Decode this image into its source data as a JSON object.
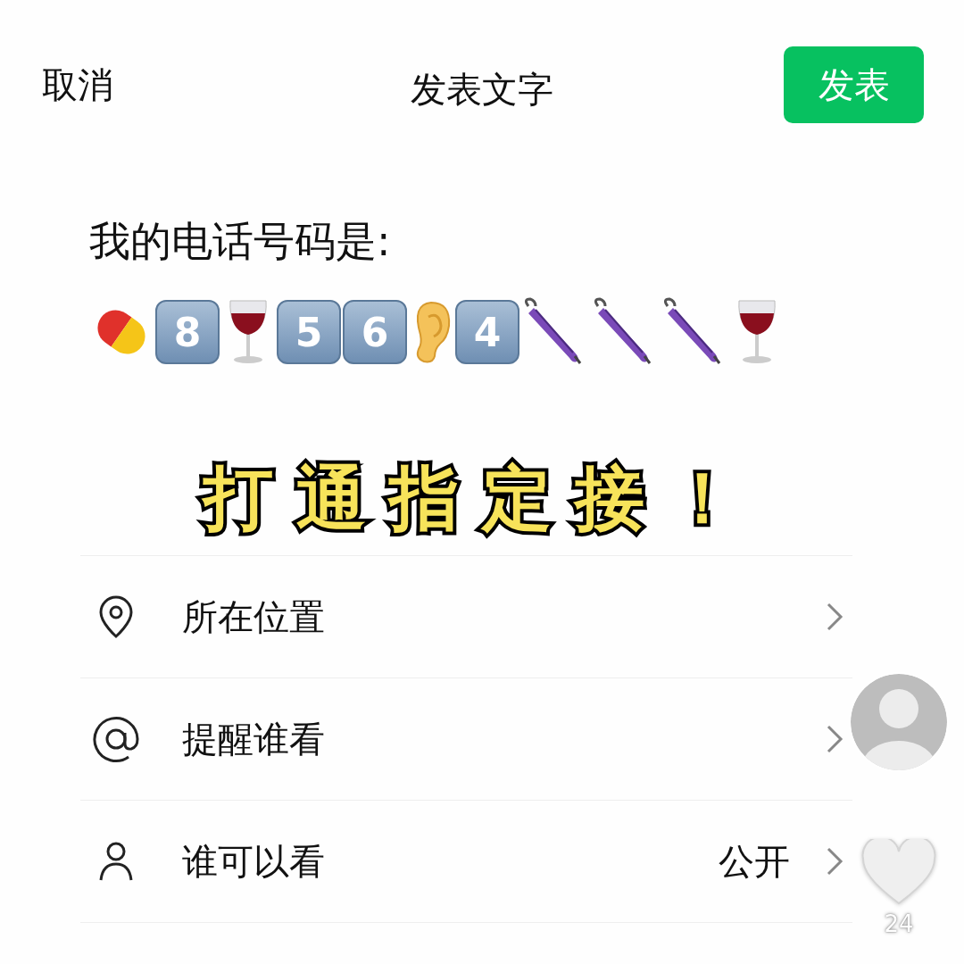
{
  "header": {
    "cancel": "取消",
    "title": "发表文字",
    "publish": "发表"
  },
  "post": {
    "text": "我的电话号码是:",
    "tokens": [
      {
        "kind": "pill"
      },
      {
        "kind": "keycap",
        "text": "8"
      },
      {
        "kind": "wine"
      },
      {
        "kind": "keycap",
        "text": "5"
      },
      {
        "kind": "keycap",
        "text": "6"
      },
      {
        "kind": "ear"
      },
      {
        "kind": "keycap",
        "text": "4"
      },
      {
        "kind": "umbrella"
      },
      {
        "kind": "umbrella"
      },
      {
        "kind": "umbrella"
      },
      {
        "kind": "wine"
      }
    ]
  },
  "caption": "打通指定接！",
  "options": [
    {
      "kind": "location",
      "label": "所在位置"
    },
    {
      "kind": "mention",
      "label": "提醒谁看"
    },
    {
      "kind": "visibility",
      "label": "谁可以看",
      "value": "公开"
    }
  ],
  "likes": {
    "count": "24"
  }
}
